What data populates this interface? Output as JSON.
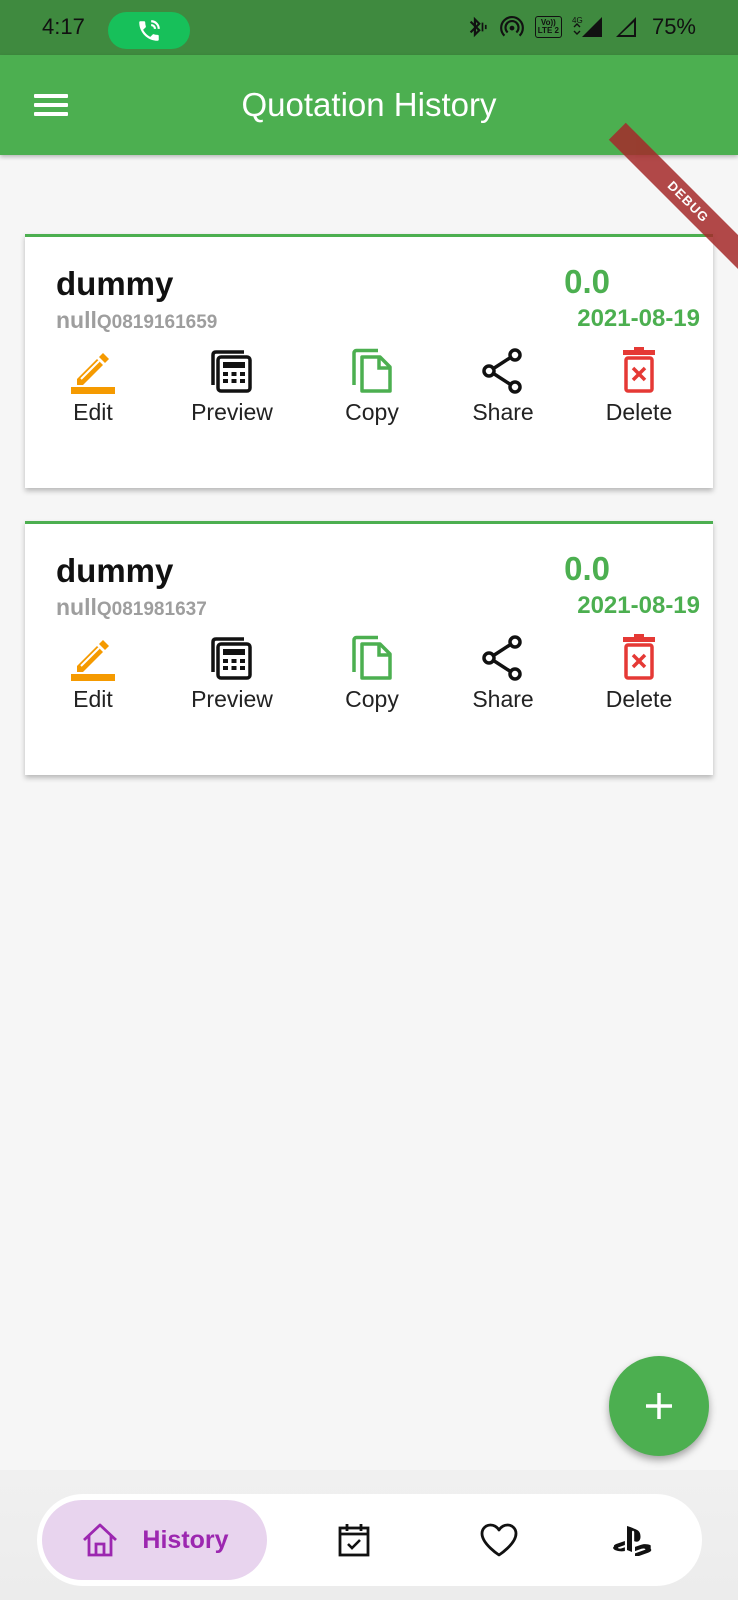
{
  "status_bar": {
    "time": "4:17",
    "battery": "75%",
    "lte_top": "Vo))",
    "lte_bottom": "LTE 2",
    "net": "4G"
  },
  "app_bar": {
    "title": "Quotation History"
  },
  "debug_banner": "DEBUG",
  "quotations": [
    {
      "customer": "dummy",
      "prefix": "null",
      "number": "Q0819161659",
      "amount": "0.0",
      "date": "2021-08-19"
    },
    {
      "customer": "dummy",
      "prefix": "null",
      "number": "Q081981637",
      "amount": "0.0",
      "date": "2021-08-19"
    }
  ],
  "actions": {
    "edit": "Edit",
    "preview": "Preview",
    "copy": "Copy",
    "share": "Share",
    "delete": "Delete"
  },
  "colors": {
    "primary": "#4caf50",
    "edit_icon": "#f59a00",
    "copy_icon": "#4caf50",
    "delete_icon": "#e53935",
    "nav_active_bg": "#e8d4ee",
    "nav_active_fg": "#9c27b0"
  },
  "bottom_nav": {
    "active_label": "History",
    "items": [
      {
        "icon": "home-icon"
      },
      {
        "icon": "calendar-check-icon"
      },
      {
        "icon": "heart-icon"
      },
      {
        "icon": "playstation-icon"
      }
    ]
  }
}
